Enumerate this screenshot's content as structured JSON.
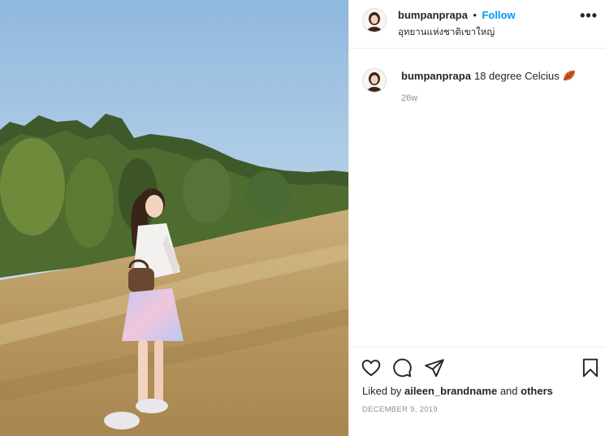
{
  "post": {
    "username": "bumpanprapa",
    "separator": "•",
    "follow_label": "Follow",
    "location": "อุทยานแห่งชาติเขาใหญ่",
    "more_icon": "more-horizontal-icon",
    "more_label": "•••"
  },
  "caption": {
    "username": "bumpanprapa",
    "text": "18 degree Celcius",
    "emoji_icon": "fallen-leaf-icon",
    "time_ago": "26w"
  },
  "actions": {
    "like_icon": "heart-icon",
    "comment_icon": "comment-bubble-icon",
    "share_icon": "paper-plane-icon",
    "save_icon": "bookmark-icon"
  },
  "likes": {
    "prefix": "Liked by",
    "user": "aileen_brandname",
    "joiner": "and",
    "others": "others"
  },
  "date": "DECEMBER 9, 2019",
  "colors": {
    "accent": "#0095f6",
    "text": "#262626",
    "muted": "#8e8e8e",
    "border": "#efefef"
  }
}
